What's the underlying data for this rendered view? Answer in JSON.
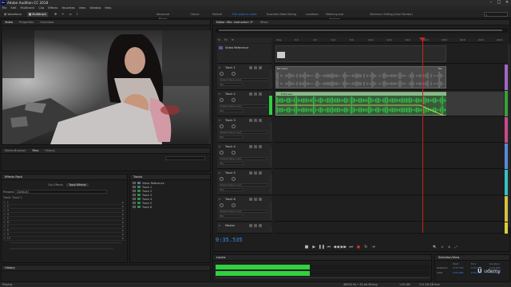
{
  "app": {
    "title": "Adobe Audition CC 2018",
    "icon": "Au"
  },
  "menu": [
    "File",
    "Edit",
    "Multitrack",
    "Clip",
    "Effects",
    "Favorites",
    "View",
    "Window",
    "Help"
  ],
  "modes": {
    "waveform": "Waveform",
    "multitrack": "Multitrack"
  },
  "workspaces": [
    "Advanced Mixing",
    "Classic",
    "Default",
    "Edit audio to video",
    "Essential Video Mixing",
    "Locations",
    "Metering and Analysis",
    "Maximum Editing (Dual Monitor)"
  ],
  "active_workspace_index": 3,
  "left_top_tabs": [
    "Video",
    "Properties",
    "Overview"
  ],
  "left_mid_tabs": [
    "Media Browser",
    "Files",
    "History"
  ],
  "effects_rack": {
    "title": "Effects Rack",
    "tabs": [
      "Clip Effects",
      "Track Effects"
    ],
    "preset_label": "Presets:",
    "preset_value": "(Default)",
    "track_label": "Track: Track 1",
    "slots": [
      "1",
      "2",
      "3",
      "4",
      "5",
      "6",
      "7",
      "8",
      "9",
      "10"
    ]
  },
  "tracks_panel": {
    "title": "Tracks",
    "items": [
      "Video Reference",
      "Track 1",
      "Track 2",
      "Track 3",
      "Track 4",
      "Track 5",
      "Track 6"
    ]
  },
  "editor": {
    "tab": "Editor: Mix: Instruction 1*",
    "mixer_tab": "Mixer",
    "ruler": [
      "hms",
      "2.0",
      "4.0",
      "6.0",
      "8.0",
      "10.0",
      "12.0",
      "14.0",
      "16.0",
      "18.0",
      "20.0",
      "22.0",
      "24.0"
    ],
    "video_track": "Video Reference",
    "tracks": [
      {
        "name": "Track 1",
        "input": "Default Stereo Input",
        "output": "Mix",
        "clip": "Bar wave",
        "color": "#a068c8"
      },
      {
        "name": "Track 2",
        "input": "Default Stereo Input",
        "output": "Mix",
        "clip": "Eddie.wav",
        "color": "#3aa03a"
      },
      {
        "name": "Track 3",
        "input": "Default Stereo Input",
        "output": "Mix",
        "clip": "",
        "color": "#c84a8a"
      },
      {
        "name": "Track 4",
        "input": "Default Stereo Input",
        "output": "Mix",
        "clip": "",
        "color": "#5a8ad8"
      },
      {
        "name": "Track 5",
        "input": "Default Stereo Input",
        "output": "Mix",
        "clip": "",
        "color": "#3ac0c0"
      },
      {
        "name": "Track 6",
        "input": "Default Stereo Input",
        "output": "Mix",
        "clip": "",
        "color": "#d8c040"
      },
      {
        "name": "Master",
        "input": "",
        "output": "",
        "clip": "",
        "color": "#d8d040"
      }
    ],
    "timecode": "0:35.535",
    "clip_tag": "Bar"
  },
  "levels": {
    "title": "Levels",
    "left": 0.44,
    "right": 0.44
  },
  "selection_view": {
    "title": "Selection/View",
    "headers": [
      "Start",
      "End",
      "Duration"
    ],
    "rows": [
      {
        "label": "Selection",
        "start": "0:35.535",
        "end": "0:35.535",
        "duration": "0:00.000"
      },
      {
        "label": "View",
        "start": "0:00.000",
        "end": "0:52.000",
        "duration": "0:52.000"
      }
    ]
  },
  "status": {
    "left": "Playing",
    "right": "48000 Hz • 32-bit Mixing",
    "size": "1.00 GB",
    "free": "212.28 GB free"
  },
  "logo": "udemy",
  "colors": {
    "accent": "#2f7fe0",
    "wave": "#2fd04a",
    "playhead": "#d02020"
  }
}
